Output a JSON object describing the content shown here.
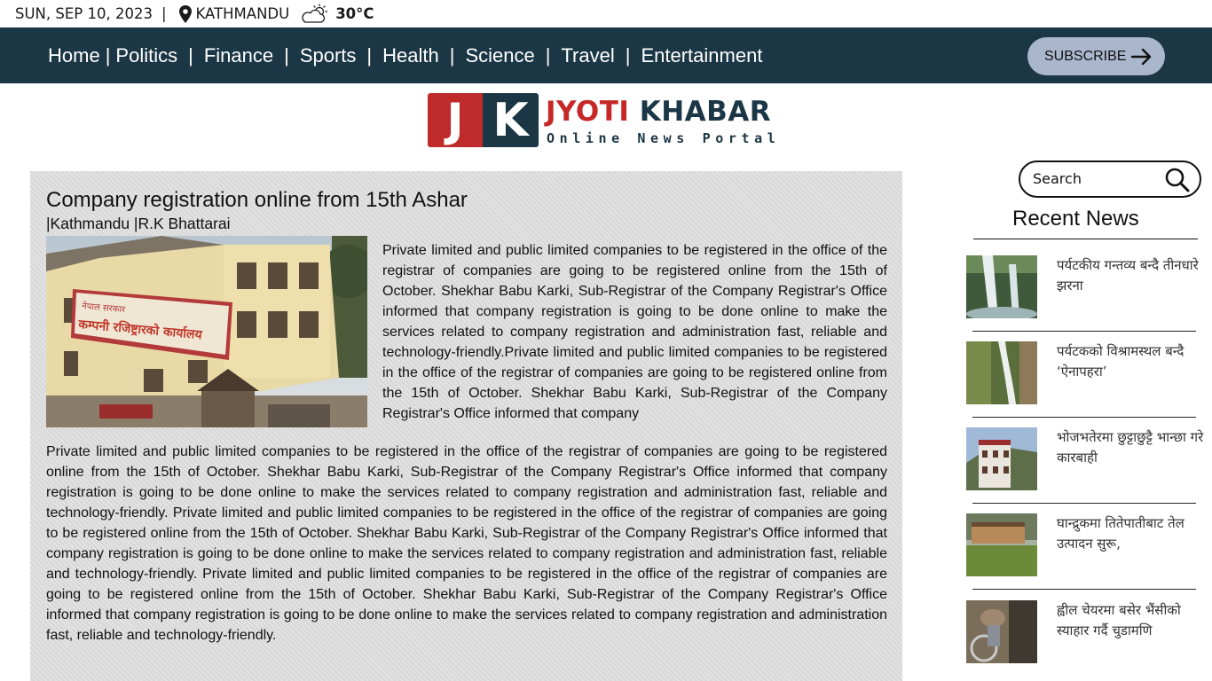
{
  "topbar": {
    "date": "SUN, SEP 10, 2023",
    "separator": "|",
    "location": "KATHMANDU",
    "temperature": "30°C",
    "icons": [
      "location-pin-icon",
      "partly-cloudy-icon"
    ]
  },
  "nav": {
    "items": [
      {
        "label": "Home"
      },
      {
        "label": "Politics"
      },
      {
        "label": "Finance"
      },
      {
        "label": "Sports"
      },
      {
        "label": "Health"
      },
      {
        "label": "Science"
      },
      {
        "label": "Travel"
      },
      {
        "label": "Entertainment"
      }
    ],
    "separator": "|",
    "subscribe_label": "SUBSCRIBE",
    "subscribe_icon": "arrow-right-icon",
    "colors": {
      "bar": "#1b3645",
      "subscribe_bg": "#a9b6cc"
    }
  },
  "logo": {
    "mark_j": "J",
    "mark_k": "K",
    "name_part1": "JYOTI",
    "name_part2": "KHABAR",
    "tagline": "Online News Portal",
    "colors": {
      "red": "#bf2a2a",
      "navy": "#1b3645"
    }
  },
  "article": {
    "title": "Company registration online from 15th Ashar",
    "byline": "|Kathmandu |R.K Bhattarai",
    "image_sign_text": "कम्पनी रजिष्ट्रारको कार्यालय",
    "paragraph1": "Private limited and public limited companies to be registered in the office of the registrar of companies are going to be registered online from the 15th of October. Shekhar Babu Karki, Sub-Registrar of the Company Registrar's Office informed that company registration is going to be done online to make the services related to company registration and administration fast, reliable and technology-friendly.Private limited and public limited companies to be registered in the office of the registrar of companies are going to be registered online from the 15th of October. Shekhar Babu Karki, Sub-Registrar of the Company Registrar's Office informed that company",
    "paragraph2": "Private limited and public limited companies to be registered in the office of the registrar of companies are going to be registered online from the 15th of October. Shekhar Babu Karki, Sub-Registrar of the Company Registrar's Office informed that company registration is going to be done online to make the services related to company registration and administration fast, reliable and technology-friendly. Private limited and public limited companies to be registered in the office of the registrar of companies are going to be registered online from the 15th of October. Shekhar Babu Karki, Sub-Registrar of the Company Registrar's Office informed that company registration is going to be done online to make the services related to company registration and administration fast, reliable and technology-friendly. Private limited and public limited companies to be registered in the office of the registrar of companies are going to be registered online from the 15th of October. Shekhar Babu Karki, Sub-Registrar of the Company Registrar's Office informed that company registration is going to be done online to make the services related to company registration and administration fast, reliable and technology-friendly."
  },
  "sidebar": {
    "search_placeholder": "Search",
    "search_icon": "search-icon",
    "recent_title": "Recent News",
    "items": [
      {
        "headline": "पर्यटकीय गन्तव्य बन्दै तीनधारे झरना"
      },
      {
        "headline": "पर्यटकको विश्रामस्थल बन्दै ‘ऐनापहरा’"
      },
      {
        "headline": "भोजभतेरमा छुट्टाछुट्टै भान्छा गरे कारबाही"
      },
      {
        "headline": "घान्द्रुकमा तितेपातीबाट तेल उत्पादन सुरू,"
      },
      {
        "headline": "ह्वील चेयरमा बसेर भैंसीको स्याहार गर्दै चुडामणि"
      }
    ]
  }
}
